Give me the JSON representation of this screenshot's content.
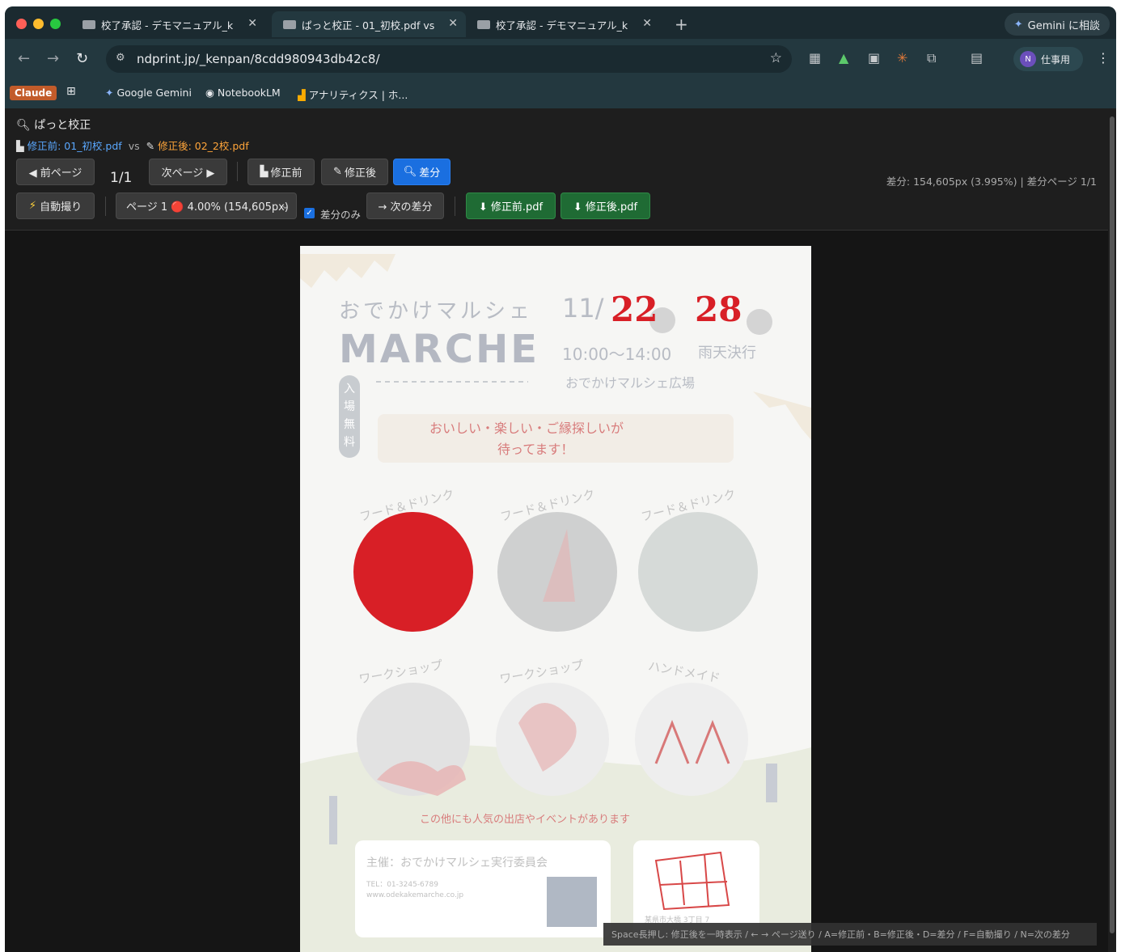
{
  "browser": {
    "tabs": [
      {
        "title": "校了承認 - デモマニュアル_k"
      },
      {
        "title": "ぱっと校正 - 01_初校.pdf vs"
      },
      {
        "title": "校了承認 - デモマニュアル_k"
      }
    ],
    "gemini_button": "Gemini に相談",
    "url": "ndprint.jp/_kenpan/8cdd980943db42c8/",
    "profile": {
      "initial": "N",
      "label": "仕事用"
    },
    "bookmarks": {
      "claude": "Claude",
      "google_gemini": "Google Gemini",
      "notebooklm": "NotebookLM",
      "analytics": "アナリティクス | ホ..."
    }
  },
  "app": {
    "title": "ぱっと校正",
    "before_file": "修正前: 01_初校.pdf",
    "vs": "vs",
    "after_file": "修正後: 02_2校.pdf",
    "prev_page": "◀ 前ページ",
    "page_counter": "1/1",
    "next_page": "次ページ ▶",
    "view_before": "修正前",
    "view_after": "修正後",
    "view_diff": "差分",
    "diff_summary": "差分: 154,605px (3.995%) | 差分ページ 1/1",
    "auto_flip": "自動撮り",
    "page_select": "ページ 1 🔴 4.00% (154,605px)",
    "diff_only": "差分のみ",
    "next_diff": "→ 次の差分",
    "download_before": "⬇ 修正前.pdf",
    "download_after": "⬇ 修正後.pdf",
    "shortcuts": "Space長押し: 修正後を一時表示 / ← → ページ送り / A=修正前・B=修正後・D=差分 / F=自動撮り / N=次の差分"
  },
  "flyer": {
    "title_jp": "おでかけマルシェ",
    "title_en": "MARCHE",
    "date_prefix": "11/",
    "date_1": "22",
    "date_2": "28",
    "time": "10:00〜14:00",
    "rain": "雨天決行",
    "venue": "おでかけマルシェ広場",
    "admission": "入場無料",
    "tagline_1": "おいしい・楽しい・ご縁探しいが",
    "tagline_2": "待ってます！",
    "labels": [
      "フード＆ドリンク",
      "フード＆ドリンク",
      "フード＆ドリンク",
      "ワークショップ",
      "ワークショップ",
      "ハンドメイド"
    ],
    "notice": "この他にも人気の出店やイベントがあります",
    "organizer": "主催：おでかけマルシェ実行委員会",
    "tel": "TEL：01-3245-6789",
    "web": "www.odekakemarche.co.jp",
    "address": "某県市大橋 3丁目 7"
  },
  "colors": {
    "diff_red": "#d81f26",
    "primary_blue": "#1a6fe0",
    "download_green": "#1f6b34"
  }
}
